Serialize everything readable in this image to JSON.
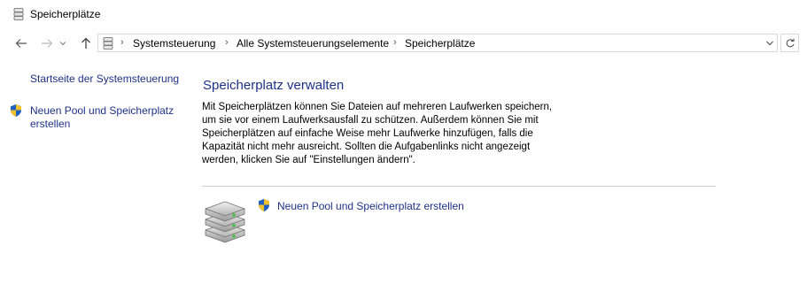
{
  "window": {
    "title": "Speicherplätze"
  },
  "address_bar": {
    "crumbs": [
      "Systemsteuerung",
      "Alle Systemsteuerungselemente",
      "Speicherplätze"
    ]
  },
  "sidebar": {
    "home_link": "Startseite der Systemsteuerung",
    "create_pool_line1": "Neuen Pool und Speicherplatz",
    "create_pool_line2": "erstellen"
  },
  "main": {
    "heading": "Speicherplatz verwalten",
    "description": [
      "Mit Speicherplätzen können Sie Dateien auf mehreren Laufwerken speichern,",
      "um sie vor einem Laufwerksausfall zu schützen. Außerdem können Sie mit",
      "Speicherplätzen auf einfache Weise mehr Laufwerke hinzufügen, falls die",
      "Kapazität nicht mehr ausreicht. Sollten die Aufgabenlinks nicht angezeigt",
      "werden, klicken Sie auf \"Einstellungen ändern\"."
    ],
    "task_link": "Neuen Pool und Speicherplatz erstellen"
  },
  "colors": {
    "link": "#1e3287",
    "border": "#d9d9d9"
  },
  "icons": [
    "storage-spaces-icon",
    "back-arrow-icon",
    "forward-arrow-icon",
    "recent-dropdown-icon",
    "up-arrow-icon",
    "chevron-right-icon",
    "chevron-down-icon",
    "refresh-icon",
    "uac-shield-icon",
    "drives-stack-icon"
  ]
}
